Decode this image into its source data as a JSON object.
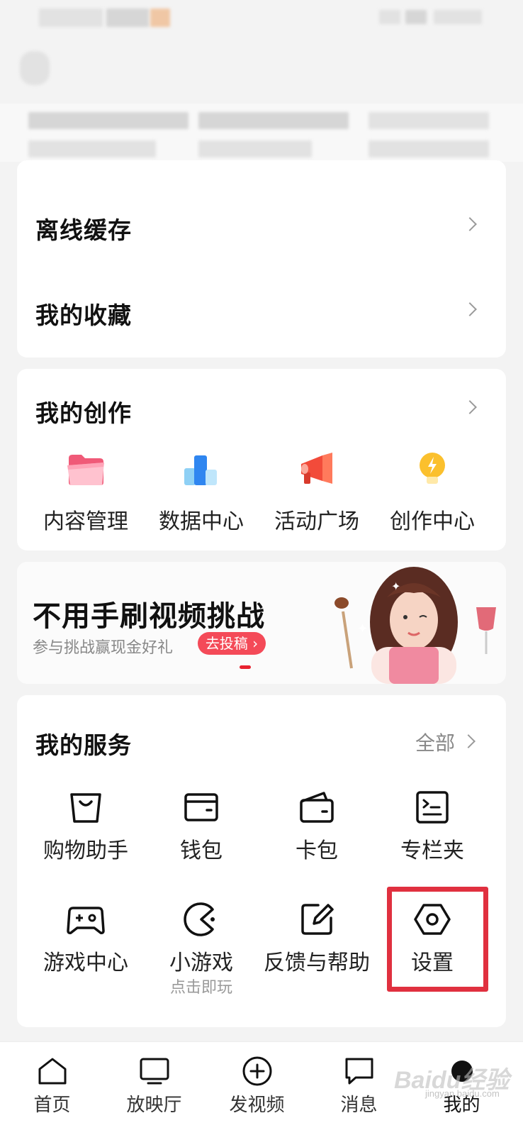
{
  "offline_cache": {
    "title": "离线缓存"
  },
  "favorites": {
    "title": "我的收藏"
  },
  "creation": {
    "title": "我的创作",
    "items": [
      {
        "label": "内容管理",
        "icon": "folder-icon"
      },
      {
        "label": "数据中心",
        "icon": "bar-chart-icon"
      },
      {
        "label": "活动广场",
        "icon": "megaphone-icon"
      },
      {
        "label": "创作中心",
        "icon": "lightbulb-icon"
      }
    ]
  },
  "banner": {
    "title": "不用手刷视频挑战",
    "subtitle": "参与挑战赢现金好礼",
    "button": "去投稿"
  },
  "services": {
    "title": "我的服务",
    "more": "全部",
    "items": [
      {
        "label": "购物助手",
        "icon": "shopping-bag-icon"
      },
      {
        "label": "钱包",
        "icon": "wallet-icon"
      },
      {
        "label": "卡包",
        "icon": "card-holder-icon"
      },
      {
        "label": "专栏夹",
        "icon": "column-folder-icon"
      },
      {
        "label": "游戏中心",
        "icon": "gamepad-icon"
      },
      {
        "label": "小游戏",
        "sublabel": "点击即玩",
        "icon": "pacman-icon"
      },
      {
        "label": "反馈与帮助",
        "icon": "edit-icon"
      },
      {
        "label": "设置",
        "icon": "hexagon-settings-icon"
      }
    ]
  },
  "bottom_nav": {
    "items": [
      {
        "label": "首页",
        "icon": "home-icon"
      },
      {
        "label": "放映厅",
        "icon": "tv-icon"
      },
      {
        "label": "发视频",
        "icon": "add-circle-icon"
      },
      {
        "label": "消息",
        "icon": "message-icon"
      },
      {
        "label": "我的",
        "icon": "profile-icon",
        "active": true
      }
    ]
  },
  "watermark": {
    "text": "Baidu经验",
    "sub": "jingyan.baidu.com"
  },
  "colors": {
    "accent": "#e8222f",
    "button": "#f44a58",
    "highlight_box": "#e0303f"
  }
}
